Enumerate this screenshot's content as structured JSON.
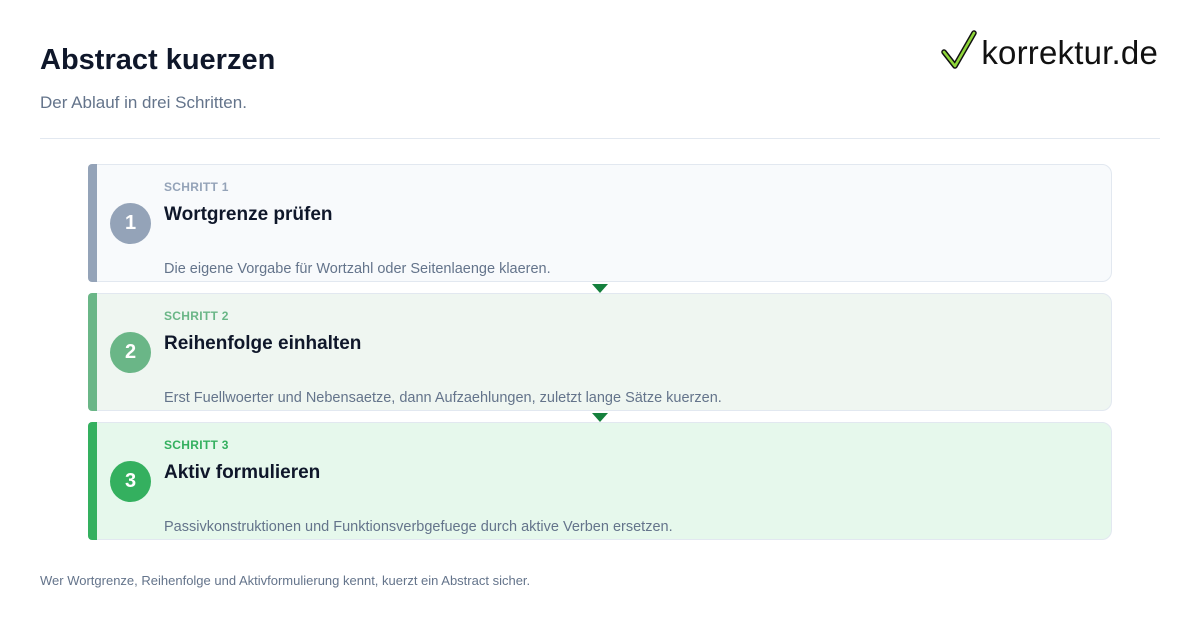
{
  "header": {
    "title": "Abstract kuerzen",
    "subtitle": "Der Ablauf in drei Schritten."
  },
  "logo": {
    "text": "korrektur.de",
    "icon": "checkmark-icon"
  },
  "steps": [
    {
      "number": "1",
      "kicker": "SCHRITT 1",
      "title": "Wortgrenze prüfen",
      "description": "Die eigene Vorgabe für Wortzahl oder Seitenlaenge klaeren.",
      "color": "#94a3b8"
    },
    {
      "number": "2",
      "kicker": "SCHRITT 2",
      "title": "Reihenfolge einhalten",
      "description": "Erst Fuellwoerter und Nebensaetze, dann Aufzaehlungen, zuletzt lange Sätze kuerzen.",
      "color": "#6ab687"
    },
    {
      "number": "3",
      "kicker": "SCHRITT 3",
      "title": "Aktiv formulieren",
      "description": "Passivkonstruktionen und Funktionsverbgefuege durch aktive Verben ersetzen.",
      "color": "#34b05f"
    }
  ],
  "footer": {
    "text": "Wer Wortgrenze, Reihenfolge und Aktivformulierung kennt, kuerzt ein Abstract sicher."
  },
  "colors": {
    "arrow": "#15803d",
    "title": "#0f172a",
    "muted": "#64748b"
  }
}
